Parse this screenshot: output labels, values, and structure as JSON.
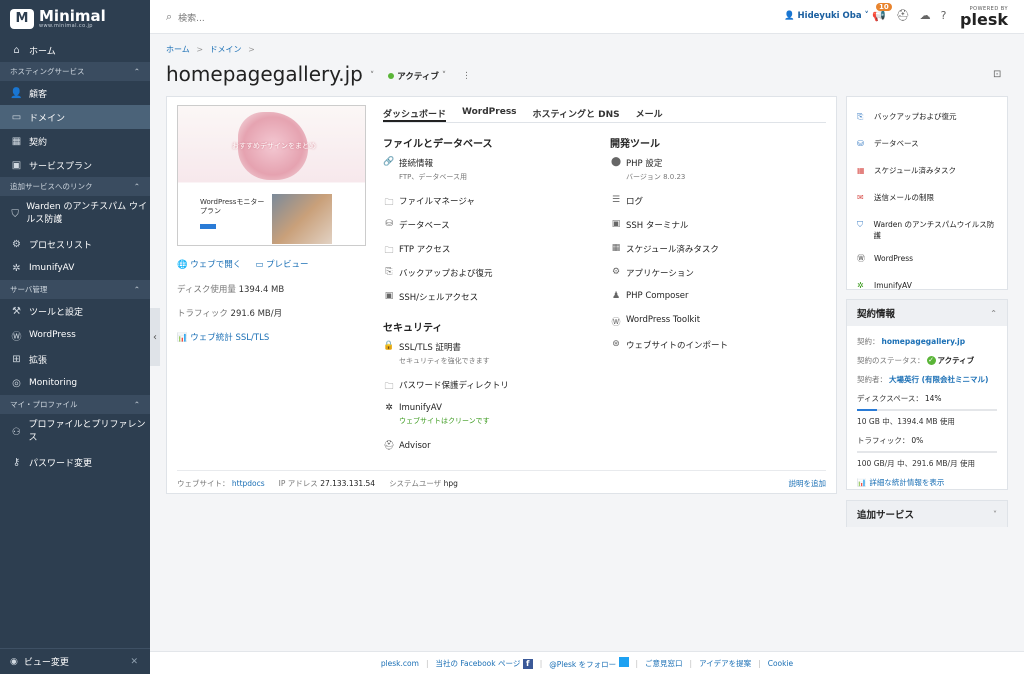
{
  "sidebar": {
    "logo": "Minimal",
    "logo_sub": "www.minimal.co.jp",
    "items": {
      "home": "ホーム",
      "hosting_section": "ホスティングサービス",
      "customers": "顧客",
      "domains": "ドメイン",
      "subscriptions": "契約",
      "service_plans": "サービスプラン",
      "links_section": "追加サービスへのリンク",
      "warden": "Warden のアンチスパム ウイルス防護",
      "processes": "プロセスリスト",
      "imunify": "ImunifyAV",
      "server_section": "サーバ管理",
      "tools": "ツールと設定",
      "wordpress": "WordPress",
      "extensions": "拡張",
      "monitoring": "Monitoring",
      "profile_section": "マイ・プロファイル",
      "profile": "プロファイルとプリファレンス",
      "password": "パスワード変更"
    },
    "view_change": "ビュー変更"
  },
  "topbar": {
    "search_placeholder": "検索...",
    "user": "Hideyuki Oba",
    "notifications": "10",
    "powered_by": "POWERED BY",
    "plesk": "plesk"
  },
  "breadcrumb": {
    "home": "ホーム",
    "sep": ">",
    "domains": "ドメイン"
  },
  "page": {
    "title": "homepagegallery.jp",
    "status": "アクティブ"
  },
  "card": {
    "preview_hero": "おすすめデザインをまとめ",
    "preview_title": "WordPressモニター プラン",
    "open_web": "ウェブで開く",
    "preview": "プレビュー",
    "disk_label": "ディスク使用量",
    "disk_value": "1394.4 MB",
    "traffic_label": "トラフィック",
    "traffic_value": "291.6 MB/月",
    "web_stats": "ウェブ統計 SSL/TLS",
    "tabs": [
      "ダッシュボード",
      "WordPress",
      "ホスティングと DNS",
      "メール"
    ],
    "files_head": "ファイルとデータベース",
    "dev_head": "開発ツール",
    "security_head": "セキュリティ",
    "connection": "接続情報",
    "connection_sub": "FTP、データベース用",
    "file_manager": "ファイルマネージャ",
    "databases": "データベース",
    "ftp": "FTP アクセス",
    "backup": "バックアップおよび復元",
    "ssh": "SSH/シェルアクセス",
    "php": "PHP 設定",
    "php_sub": "バージョン 8.0.23",
    "logs": "ログ",
    "ssh_terminal": "SSH ターミナル",
    "scheduled": "スケジュール済みタスク",
    "apps": "アプリケーション",
    "composer": "PHP Composer",
    "wp_toolkit": "WordPress Toolkit",
    "import": "ウェブサイトのインポート",
    "ssl": "SSL/TLS 証明書",
    "ssl_sub": "セキュリティを強化できます",
    "protected_dirs": "パスワード保護ディレクトリ",
    "imunify": "ImunifyAV",
    "imunify_sub": "ウェブサイトはクリーンです",
    "advisor": "Advisor",
    "footer_site_label": "ウェブサイト：",
    "footer_site_value": "httpdocs",
    "footer_ip_label": "IP アドレス",
    "footer_ip_value": "27.133.131.54",
    "footer_user_label": "システムユーザ",
    "footer_user_value": "hpg",
    "footer_desc": "説明を追加"
  },
  "right": {
    "quick": {
      "backup": "バックアップおよび復元",
      "databases": "データベース",
      "scheduled": "スケジュール済みタスク",
      "mail_limit": "送信メールの制限",
      "warden": "Warden のアンチスパムウイルス防護",
      "wordpress": "WordPress",
      "imunify": "ImunifyAV"
    },
    "subscription": {
      "head": "契約情報",
      "sub_label": "契約：",
      "sub_value": "homepagegallery.jp",
      "status_label": "契約のステータス：",
      "status_value": "アクティブ",
      "owner_label": "契約者：",
      "owner_value": "大場英行 (有限会社ミニマル)",
      "disk_label": "ディスクスペース：",
      "disk_pct": "14%",
      "disk_fraction": 0.14,
      "disk_detail": "10 GB 中、1394.4 MB 使用",
      "traffic_label": "トラフィック：",
      "traffic_pct": "0%",
      "traffic_fraction": 0.0,
      "traffic_detail": "100 GB/月 中、291.6 MB/月 使用",
      "stats_link": "詳細な統計情報を表示"
    },
    "additional": "追加サービス"
  },
  "footer": {
    "plesk": "plesk.com",
    "facebook": "当社の Facebook ページ",
    "twitter": "@Plesk をフォロー",
    "contact": "ご意見窓口",
    "ideas": "アイデアを提案",
    "cookie": "Cookie"
  },
  "colors": {
    "sidebar": "#2d3e50",
    "active": "#4b6379",
    "link": "#1a6fb5",
    "status": "#5ab538",
    "badge": "#e8842e"
  }
}
